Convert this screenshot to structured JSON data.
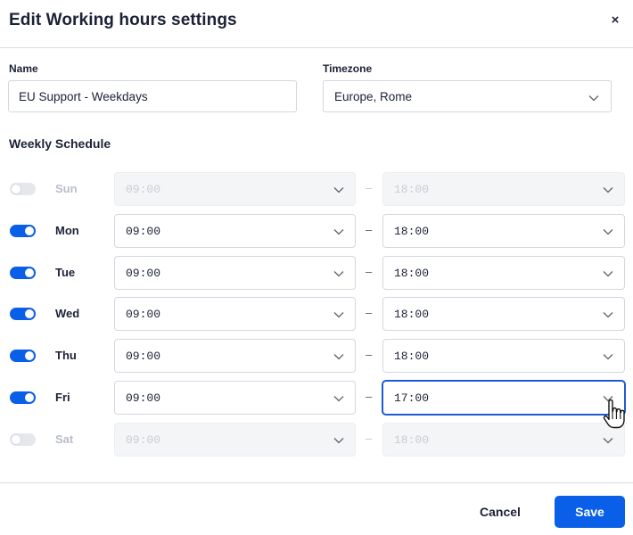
{
  "dialog": {
    "title": "Edit Working hours settings",
    "close_label": "×"
  },
  "form": {
    "name_label": "Name",
    "name_value": "EU Support - Weekdays",
    "timezone_label": "Timezone",
    "timezone_value": "Europe, Rome"
  },
  "schedule": {
    "title": "Weekly Schedule",
    "separator": "–",
    "days": [
      {
        "day": "Sun",
        "enabled": false,
        "start": "09:00",
        "end": "18:00"
      },
      {
        "day": "Mon",
        "enabled": true,
        "start": "09:00",
        "end": "18:00"
      },
      {
        "day": "Tue",
        "enabled": true,
        "start": "09:00",
        "end": "18:00"
      },
      {
        "day": "Wed",
        "enabled": true,
        "start": "09:00",
        "end": "18:00"
      },
      {
        "day": "Thu",
        "enabled": true,
        "start": "09:00",
        "end": "18:00"
      },
      {
        "day": "Fri",
        "enabled": true,
        "start": "09:00",
        "end": "17:00",
        "end_active": true
      },
      {
        "day": "Sat",
        "enabled": false,
        "start": "09:00",
        "end": "18:00"
      }
    ]
  },
  "footer": {
    "cancel_label": "Cancel",
    "save_label": "Save"
  },
  "colors": {
    "accent": "#0a5fe8",
    "text": "#1b2236",
    "disabled_text": "#b8bdc7"
  },
  "icons": [
    "close-icon",
    "chevron-down-icon",
    "toggle-switch",
    "hand-pointer-cursor"
  ]
}
